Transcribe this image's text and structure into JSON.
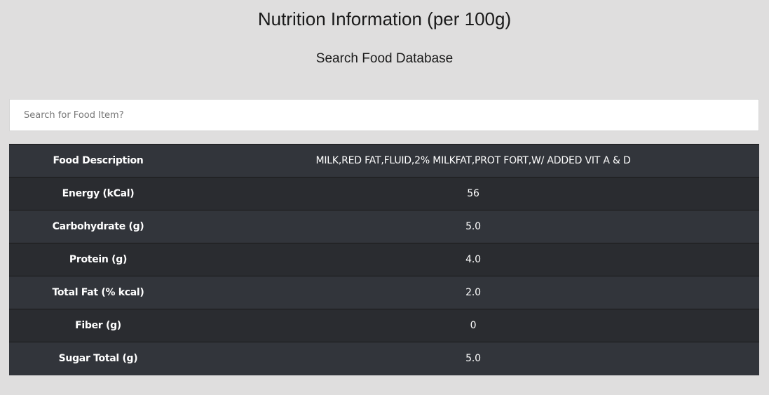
{
  "header": {
    "title": "Nutrition Information (per 100g)",
    "subtitle": "Search Food Database"
  },
  "search": {
    "placeholder": "Search for Food Item?",
    "value": ""
  },
  "table": {
    "rows": [
      {
        "label": "Food Description",
        "value": "MILK,RED FAT,FLUID,2% MILKFAT,PROT FORT,W/ ADDED VIT A & D"
      },
      {
        "label": "Energy (kCal)",
        "value": "56"
      },
      {
        "label": "Carbohydrate (g)",
        "value": "5.0"
      },
      {
        "label": "Protein (g)",
        "value": "4.0"
      },
      {
        "label": "Total Fat (% kcal)",
        "value": "2.0"
      },
      {
        "label": "Fiber (g)",
        "value": "0"
      },
      {
        "label": "Sugar Total (g)",
        "value": "5.0"
      }
    ]
  },
  "colors": {
    "background": "#dfdede",
    "row_odd": "#32353b",
    "row_even": "#2a2c30",
    "text_light": "#ffffff"
  }
}
